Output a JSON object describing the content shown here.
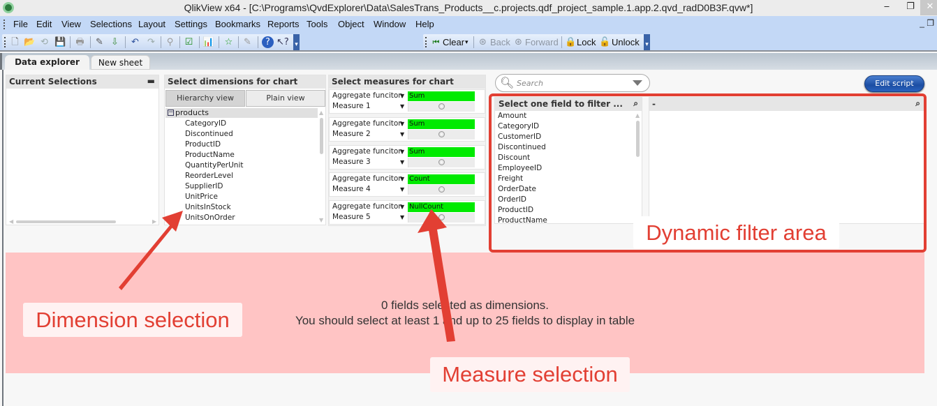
{
  "window": {
    "title": "QlikView x64 - [C:\\Programs\\QvdExplorer\\Data\\SalesTrans_Products__c.projects.qdf_project_sample.1.app.2.qvd_radD0B3F.qvw*]",
    "minimize": "‒",
    "maximize": "❐",
    "close": "✕"
  },
  "menubar": {
    "items": [
      "File",
      "Edit",
      "View",
      "Selections",
      "Layout",
      "Settings",
      "Bookmarks",
      "Reports",
      "Tools",
      "Object",
      "Window",
      "Help"
    ],
    "mdi_controls": "_ ❐"
  },
  "toolbar": {
    "icons": [
      "new-icon",
      "open-icon",
      "reload-icon",
      "save-icon",
      "print-icon",
      "edit-script-icon",
      "reload-data-icon",
      "undo-icon",
      "redo-icon",
      "search-icon",
      "selections-icon",
      "chart-icon",
      "bookmark-star-icon",
      "properties-icon",
      "help-icon",
      "context-help-icon"
    ],
    "clear_label": "Clear",
    "back_label": "Back",
    "forward_label": "Forward",
    "lock_label": "Lock",
    "unlock_label": "Unlock"
  },
  "tabs": [
    {
      "label": "Data explorer",
      "active": true
    },
    {
      "label": "New sheet",
      "active": false
    }
  ],
  "current_selections": {
    "title": "Current Selections",
    "minimize": "▬"
  },
  "dimensions": {
    "title": "Select dimensions for chart",
    "hierarchy_view_label": "Hierarchy view",
    "plain_view_label": "Plain view",
    "group": {
      "label": "products",
      "toggle": "−"
    },
    "fields": [
      "CategoryID",
      "Discontinued",
      "ProductID",
      "ProductName",
      "QuantityPerUnit",
      "ReorderLevel",
      "SupplierID",
      "UnitPrice",
      "UnitsInStock",
      "UnitsOnOrder"
    ]
  },
  "measures": {
    "title": "Select measures for chart",
    "rows": [
      {
        "aggregate_label": "Aggregate funciton",
        "aggregate_value": "Sum",
        "measure_label": "Measure 1"
      },
      {
        "aggregate_label": "Aggregate funciton",
        "aggregate_value": "Sum",
        "measure_label": "Measure 2"
      },
      {
        "aggregate_label": "Aggregate funciton",
        "aggregate_value": "Sum",
        "measure_label": "Measure 3"
      },
      {
        "aggregate_label": "Aggregate funciton",
        "aggregate_value": "Count",
        "measure_label": "Measure 4"
      },
      {
        "aggregate_label": "Aggregate funciton",
        "aggregate_value": "NullCount",
        "measure_label": "Measure 5"
      }
    ]
  },
  "search": {
    "placeholder": "Search"
  },
  "edit_script_label": "Edit script",
  "filter": {
    "field_list_title": "Select one field to filter ...",
    "values_title": "-",
    "fields": [
      "Amount",
      "CategoryID",
      "CustomerID",
      "Discontinued",
      "Discount",
      "EmployeeID",
      "Freight",
      "OrderDate",
      "OrderID",
      "ProductID",
      "ProductName"
    ]
  },
  "message": {
    "line1": "0 fields selected as dimensions.",
    "line2": "You should select at least 1 and up to 25 fields to display in table"
  },
  "annotations": {
    "dimension": "Dimension selection",
    "measure": "Measure selection",
    "filter": "Dynamic filter area",
    "color": "#e23f33"
  },
  "colors": {
    "accent_green": "#00ea00",
    "message_bg": "#ffc4c4",
    "menubar_bg": "#c3d8f6",
    "edit_script_bg": "#1c4ea3"
  }
}
